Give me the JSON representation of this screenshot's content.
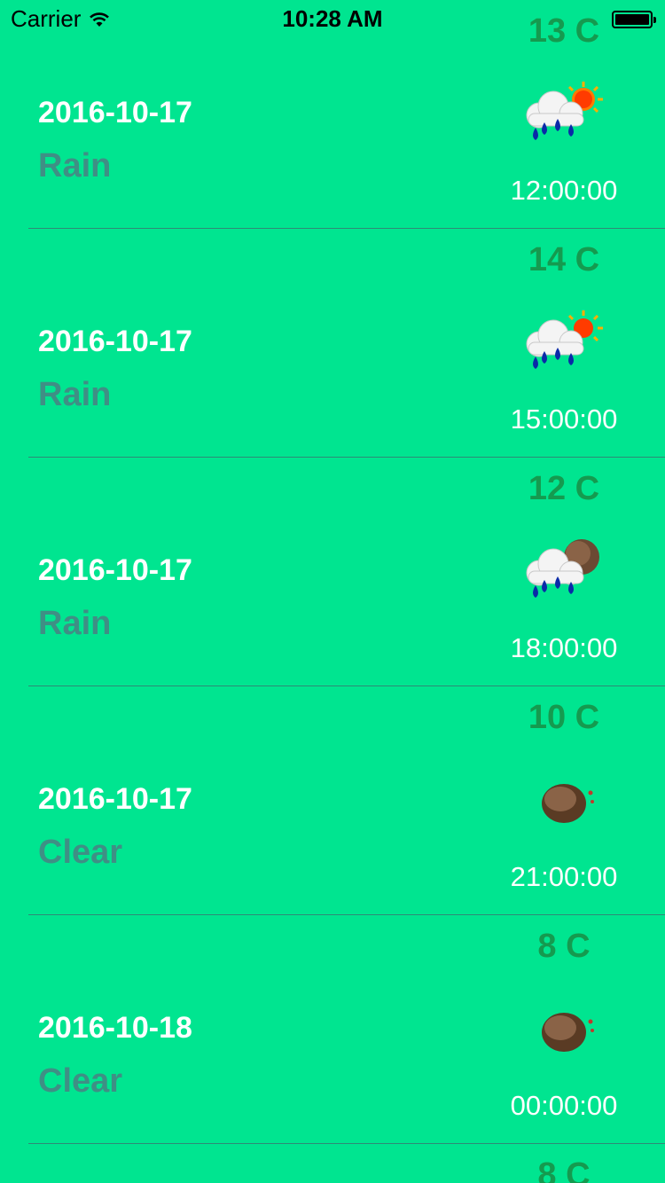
{
  "status_bar": {
    "carrier": "Carrier",
    "time": "10:28 AM"
  },
  "forecast": [
    {
      "date": "2016-10-17",
      "condition": "Rain",
      "temp": "13 C",
      "time": "12:00:00",
      "icon": "rain-sun-icon"
    },
    {
      "date": "2016-10-17",
      "condition": "Rain",
      "temp": "14 C",
      "time": "15:00:00",
      "icon": "rain-sun-icon"
    },
    {
      "date": "2016-10-17",
      "condition": "Rain",
      "temp": "12 C",
      "time": "18:00:00",
      "icon": "rain-moon-icon"
    },
    {
      "date": "2016-10-17",
      "condition": "Clear",
      "temp": "10 C",
      "time": "21:00:00",
      "icon": "moon-icon"
    },
    {
      "date": "2016-10-18",
      "condition": "Clear",
      "temp": "8 C",
      "time": "00:00:00",
      "icon": "moon-icon"
    },
    {
      "date": "",
      "condition": "",
      "temp": "8 C",
      "time": "",
      "icon": ""
    }
  ],
  "colors": {
    "background": "#00e590",
    "date_text": "#ffffff",
    "condition_text": "#3f8f85",
    "temp_text": "#159a4f"
  }
}
